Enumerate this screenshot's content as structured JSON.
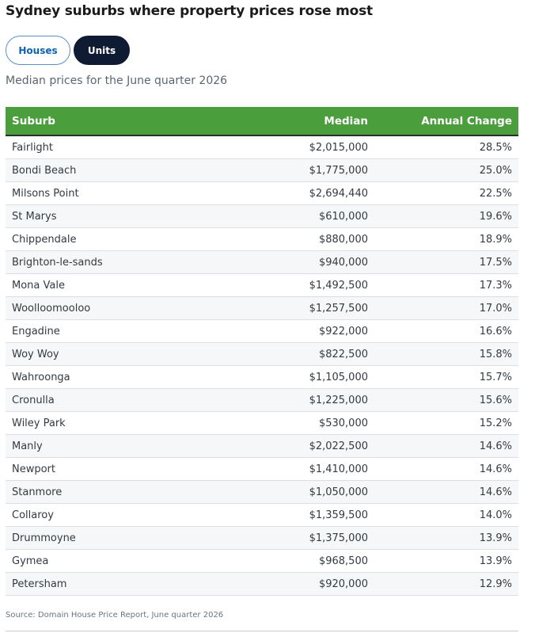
{
  "title": "Sydney suburbs where property prices rose most",
  "tabs": [
    {
      "label": "Houses",
      "active": false
    },
    {
      "label": "Units",
      "active": true
    }
  ],
  "subtitle": "Median prices for the June quarter 2026",
  "colors": {
    "header_bg": "#4a9e3c",
    "active_tab": "#0f1a33",
    "inactive_tab_text": "#0f63b5"
  },
  "chart_data": {
    "type": "table",
    "columns": [
      "Suburb",
      "Median",
      "Annual Change"
    ],
    "rows": [
      [
        "Fairlight",
        "$2,015,000",
        "28.5%"
      ],
      [
        "Bondi Beach",
        "$1,775,000",
        "25.0%"
      ],
      [
        "Milsons Point",
        "$2,694,440",
        "22.5%"
      ],
      [
        "St Marys",
        "$610,000",
        "19.6%"
      ],
      [
        "Chippendale",
        "$880,000",
        "18.9%"
      ],
      [
        "Brighton-le-sands",
        "$940,000",
        "17.5%"
      ],
      [
        "Mona Vale",
        "$1,492,500",
        "17.3%"
      ],
      [
        "Woolloomooloo",
        "$1,257,500",
        "17.0%"
      ],
      [
        "Engadine",
        "$922,000",
        "16.6%"
      ],
      [
        "Woy Woy",
        "$822,500",
        "15.8%"
      ],
      [
        "Wahroonga",
        "$1,105,000",
        "15.7%"
      ],
      [
        "Cronulla",
        "$1,225,000",
        "15.6%"
      ],
      [
        "Wiley Park",
        "$530,000",
        "15.2%"
      ],
      [
        "Manly",
        "$2,022,500",
        "14.6%"
      ],
      [
        "Newport",
        "$1,410,000",
        "14.6%"
      ],
      [
        "Stanmore",
        "$1,050,000",
        "14.6%"
      ],
      [
        "Collaroy",
        "$1,359,500",
        "14.0%"
      ],
      [
        "Drummoyne",
        "$1,375,000",
        "13.9%"
      ],
      [
        "Gymea",
        "$968,500",
        "13.9%"
      ],
      [
        "Petersham",
        "$920,000",
        "12.9%"
      ]
    ]
  },
  "source": "Source: Domain House Price Report, June quarter 2026"
}
